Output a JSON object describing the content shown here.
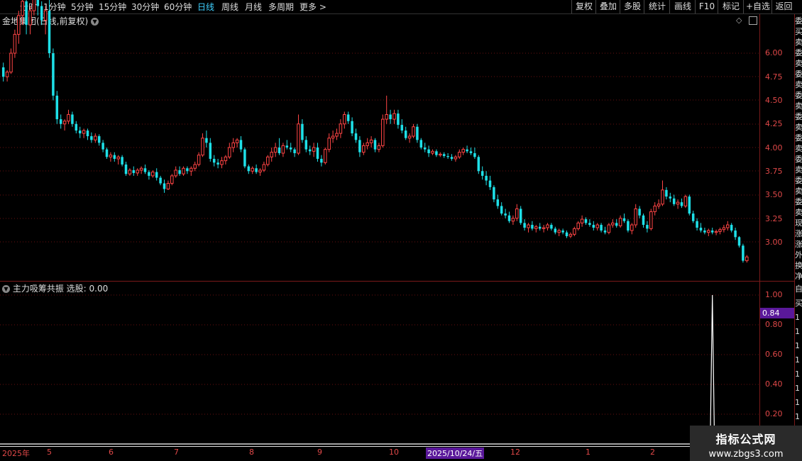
{
  "toolbar": {
    "periods": [
      "分时",
      "1分钟",
      "5分钟",
      "15分钟",
      "30分钟",
      "60分钟",
      "日线",
      "周线",
      "月线",
      "多周期",
      "更多 >"
    ],
    "active_period": "日线",
    "right_buttons": [
      "复权",
      "叠加",
      "多股",
      "统计",
      "画线",
      "F10",
      "标记",
      "+自选",
      "返回"
    ]
  },
  "main_chart": {
    "title": "金地集团(日线,前复权)",
    "y_ticks": [
      "6.00",
      "4.75",
      "4.50",
      "4.25",
      "4.00",
      "3.75",
      "3.50",
      "3.25",
      "3.00"
    ]
  },
  "indicator": {
    "title": "主力吸筹共振",
    "select_label": "选股: 0.00",
    "current_value": "0.84",
    "y_ticks": [
      "1.00",
      "0.80",
      "0.60",
      "0.40",
      "0.20"
    ]
  },
  "x_axis": {
    "labels": [
      "2025年",
      "5",
      "6",
      "7",
      "8",
      "9",
      "10",
      "2025/10/24/五",
      "12",
      "1",
      "2"
    ],
    "highlight": "2025/10/24/五"
  },
  "watermark": {
    "line1": "指标公式网",
    "line2": "www.zbgs3.com"
  },
  "side_column": {
    "top_chars": "委买卖委卖委卖委卖委卖委卖委卖委卖委卖现涨涨外换净收",
    "bottom_chars": "自买1111111111"
  },
  "colors": {
    "up": "#ff4545",
    "down": "#1ee0e8",
    "axis": "#e04848",
    "highlight": "#5a189a"
  },
  "chart_data": {
    "type": "candlestick",
    "ohlc": [
      [
        4.85,
        4.9,
        4.7,
        4.75
      ],
      [
        4.75,
        4.82,
        4.7,
        4.8
      ],
      [
        4.8,
        5.05,
        4.78,
        5.0
      ],
      [
        5.0,
        5.25,
        4.95,
        5.2
      ],
      [
        5.2,
        5.45,
        5.1,
        5.4
      ],
      [
        5.4,
        5.6,
        5.3,
        5.55
      ],
      [
        5.55,
        5.6,
        5.2,
        5.3
      ],
      [
        5.3,
        5.5,
        5.2,
        5.45
      ],
      [
        5.45,
        5.7,
        5.4,
        5.65
      ],
      [
        5.65,
        5.7,
        5.4,
        5.5
      ],
      [
        5.5,
        5.55,
        5.3,
        5.35
      ],
      [
        5.35,
        5.5,
        5.2,
        5.45
      ],
      [
        5.45,
        5.6,
        4.95,
        5.0
      ],
      [
        5.0,
        5.05,
        4.5,
        4.55
      ],
      [
        4.55,
        4.6,
        4.25,
        4.3
      ],
      [
        4.3,
        4.35,
        4.2,
        4.25
      ],
      [
        4.25,
        4.3,
        4.18,
        4.28
      ],
      [
        4.28,
        4.4,
        4.25,
        4.35
      ],
      [
        4.35,
        4.38,
        4.22,
        4.25
      ],
      [
        4.25,
        4.28,
        4.15,
        4.18
      ],
      [
        4.18,
        4.22,
        4.1,
        4.15
      ],
      [
        4.15,
        4.2,
        4.1,
        4.18
      ],
      [
        4.18,
        4.2,
        4.08,
        4.12
      ],
      [
        4.12,
        4.16,
        4.05,
        4.08
      ],
      [
        4.08,
        4.15,
        4.05,
        4.12
      ],
      [
        4.12,
        4.14,
        4.02,
        4.05
      ],
      [
        4.05,
        4.08,
        3.95,
        3.98
      ],
      [
        3.98,
        4.0,
        3.88,
        3.9
      ],
      [
        3.9,
        3.95,
        3.85,
        3.92
      ],
      [
        3.92,
        3.95,
        3.85,
        3.88
      ],
      [
        3.88,
        3.92,
        3.82,
        3.9
      ],
      [
        3.9,
        3.92,
        3.8,
        3.82
      ],
      [
        3.82,
        3.85,
        3.7,
        3.72
      ],
      [
        3.72,
        3.78,
        3.7,
        3.76
      ],
      [
        3.76,
        3.8,
        3.7,
        3.73
      ],
      [
        3.73,
        3.78,
        3.7,
        3.76
      ],
      [
        3.76,
        3.8,
        3.72,
        3.78
      ],
      [
        3.78,
        3.82,
        3.72,
        3.74
      ],
      [
        3.74,
        3.76,
        3.66,
        3.7
      ],
      [
        3.7,
        3.76,
        3.68,
        3.74
      ],
      [
        3.74,
        3.78,
        3.65,
        3.68
      ],
      [
        3.68,
        3.7,
        3.6,
        3.62
      ],
      [
        3.62,
        3.66,
        3.52,
        3.56
      ],
      [
        3.56,
        3.65,
        3.55,
        3.62
      ],
      [
        3.62,
        3.72,
        3.6,
        3.7
      ],
      [
        3.7,
        3.8,
        3.68,
        3.76
      ],
      [
        3.76,
        3.8,
        3.7,
        3.72
      ],
      [
        3.72,
        3.8,
        3.7,
        3.78
      ],
      [
        3.78,
        3.8,
        3.72,
        3.75
      ],
      [
        3.75,
        3.8,
        3.7,
        3.78
      ],
      [
        3.78,
        3.85,
        3.75,
        3.82
      ],
      [
        3.82,
        3.95,
        3.8,
        3.92
      ],
      [
        3.92,
        4.15,
        3.9,
        4.1
      ],
      [
        4.1,
        4.18,
        4.0,
        4.05
      ],
      [
        4.05,
        4.1,
        3.85,
        3.88
      ],
      [
        3.88,
        3.92,
        3.8,
        3.84
      ],
      [
        3.84,
        3.88,
        3.78,
        3.82
      ],
      [
        3.82,
        3.9,
        3.78,
        3.86
      ],
      [
        3.86,
        3.92,
        3.82,
        3.9
      ],
      [
        3.9,
        4.05,
        3.88,
        4.0
      ],
      [
        4.0,
        4.1,
        3.95,
        4.05
      ],
      [
        4.05,
        4.1,
        4.0,
        4.08
      ],
      [
        4.08,
        4.12,
        3.95,
        3.98
      ],
      [
        3.98,
        4.0,
        3.78,
        3.8
      ],
      [
        3.8,
        3.82,
        3.72,
        3.75
      ],
      [
        3.75,
        3.8,
        3.72,
        3.78
      ],
      [
        3.78,
        3.82,
        3.72,
        3.74
      ],
      [
        3.74,
        3.78,
        3.7,
        3.76
      ],
      [
        3.76,
        3.85,
        3.74,
        3.82
      ],
      [
        3.82,
        3.92,
        3.8,
        3.9
      ],
      [
        3.9,
        4.0,
        3.85,
        3.95
      ],
      [
        3.95,
        4.05,
        3.9,
        4.0
      ],
      [
        4.0,
        4.1,
        3.92,
        3.94
      ],
      [
        3.94,
        4.05,
        3.9,
        4.02
      ],
      [
        4.02,
        4.08,
        3.98,
        4.0
      ],
      [
        4.0,
        4.05,
        3.95,
        3.98
      ],
      [
        3.98,
        4.0,
        3.9,
        3.94
      ],
      [
        3.94,
        4.35,
        3.92,
        4.25
      ],
      [
        4.25,
        4.3,
        4.05,
        4.08
      ],
      [
        4.08,
        4.12,
        3.95,
        3.98
      ],
      [
        3.98,
        4.02,
        3.92,
        3.96
      ],
      [
        3.96,
        4.05,
        3.9,
        4.0
      ],
      [
        4.0,
        4.05,
        3.85,
        3.88
      ],
      [
        3.88,
        3.92,
        3.8,
        3.84
      ],
      [
        3.84,
        4.0,
        3.82,
        3.98
      ],
      [
        3.98,
        4.15,
        3.95,
        4.1
      ],
      [
        4.1,
        4.18,
        4.05,
        4.12
      ],
      [
        4.12,
        4.2,
        4.08,
        4.15
      ],
      [
        4.15,
        4.3,
        4.1,
        4.25
      ],
      [
        4.25,
        4.38,
        4.2,
        4.35
      ],
      [
        4.35,
        4.38,
        4.25,
        4.28
      ],
      [
        4.28,
        4.32,
        4.12,
        4.15
      ],
      [
        4.15,
        4.2,
        4.05,
        4.08
      ],
      [
        4.08,
        4.12,
        3.9,
        3.95
      ],
      [
        3.95,
        4.05,
        3.92,
        4.02
      ],
      [
        4.02,
        4.1,
        3.98,
        4.05
      ],
      [
        4.05,
        4.12,
        4.0,
        4.08
      ],
      [
        4.08,
        4.1,
        3.95,
        3.98
      ],
      [
        3.98,
        4.05,
        3.95,
        4.02
      ],
      [
        4.02,
        4.35,
        4.0,
        4.3
      ],
      [
        4.3,
        4.55,
        4.25,
        4.35
      ],
      [
        4.35,
        4.4,
        4.25,
        4.3
      ],
      [
        4.3,
        4.4,
        4.25,
        4.36
      ],
      [
        4.36,
        4.4,
        4.2,
        4.24
      ],
      [
        4.24,
        4.3,
        4.15,
        4.18
      ],
      [
        4.18,
        4.22,
        4.08,
        4.1
      ],
      [
        4.1,
        4.15,
        4.05,
        4.12
      ],
      [
        4.12,
        4.25,
        4.1,
        4.22
      ],
      [
        4.22,
        4.25,
        4.05,
        4.08
      ],
      [
        4.08,
        4.1,
        3.98,
        4.0
      ],
      [
        4.0,
        4.05,
        3.95,
        3.98
      ],
      [
        3.98,
        4.02,
        3.9,
        3.94
      ],
      [
        3.94,
        3.98,
        3.92,
        3.96
      ],
      [
        3.96,
        3.98,
        3.9,
        3.92
      ],
      [
        3.92,
        3.95,
        3.9,
        3.93
      ],
      [
        3.93,
        3.95,
        3.89,
        3.91
      ],
      [
        3.91,
        3.94,
        3.88,
        3.9
      ],
      [
        3.9,
        3.93,
        3.86,
        3.88
      ],
      [
        3.88,
        3.92,
        3.85,
        3.9
      ],
      [
        3.9,
        3.98,
        3.88,
        3.95
      ],
      [
        3.95,
        4.0,
        3.92,
        3.98
      ],
      [
        3.98,
        4.02,
        3.94,
        3.96
      ],
      [
        3.96,
        4.0,
        3.92,
        3.94
      ],
      [
        3.94,
        4.0,
        3.88,
        3.9
      ],
      [
        3.9,
        3.92,
        3.72,
        3.75
      ],
      [
        3.75,
        3.8,
        3.66,
        3.7
      ],
      [
        3.7,
        3.75,
        3.6,
        3.65
      ],
      [
        3.65,
        3.7,
        3.55,
        3.58
      ],
      [
        3.58,
        3.6,
        3.42,
        3.45
      ],
      [
        3.45,
        3.5,
        3.35,
        3.38
      ],
      [
        3.38,
        3.42,
        3.28,
        3.3
      ],
      [
        3.3,
        3.35,
        3.25,
        3.28
      ],
      [
        3.28,
        3.32,
        3.2,
        3.22
      ],
      [
        3.22,
        3.28,
        3.18,
        3.25
      ],
      [
        3.25,
        3.4,
        3.22,
        3.35
      ],
      [
        3.35,
        3.38,
        3.18,
        3.2
      ],
      [
        3.2,
        3.24,
        3.12,
        3.15
      ],
      [
        3.15,
        3.2,
        3.1,
        3.18
      ],
      [
        3.18,
        3.22,
        3.12,
        3.14
      ],
      [
        3.14,
        3.18,
        3.1,
        3.16
      ],
      [
        3.16,
        3.2,
        3.12,
        3.14
      ],
      [
        3.14,
        3.18,
        3.1,
        3.15
      ],
      [
        3.15,
        3.2,
        3.12,
        3.18
      ],
      [
        3.18,
        3.2,
        3.12,
        3.14
      ],
      [
        3.14,
        3.16,
        3.08,
        3.1
      ],
      [
        3.1,
        3.14,
        3.06,
        3.12
      ],
      [
        3.12,
        3.14,
        3.08,
        3.1
      ],
      [
        3.1,
        3.12,
        3.04,
        3.06
      ],
      [
        3.06,
        3.1,
        3.04,
        3.08
      ],
      [
        3.08,
        3.16,
        3.06,
        3.14
      ],
      [
        3.14,
        3.22,
        3.12,
        3.2
      ],
      [
        3.2,
        3.28,
        3.16,
        3.24
      ],
      [
        3.24,
        3.26,
        3.18,
        3.2
      ],
      [
        3.2,
        3.24,
        3.16,
        3.18
      ],
      [
        3.18,
        3.22,
        3.12,
        3.15
      ],
      [
        3.15,
        3.2,
        3.12,
        3.18
      ],
      [
        3.18,
        3.2,
        3.1,
        3.12
      ],
      [
        3.12,
        3.16,
        3.08,
        3.1
      ],
      [
        3.1,
        3.2,
        3.08,
        3.18
      ],
      [
        3.18,
        3.24,
        3.15,
        3.2
      ],
      [
        3.2,
        3.24,
        3.15,
        3.17
      ],
      [
        3.17,
        3.28,
        3.15,
        3.25
      ],
      [
        3.25,
        3.3,
        3.2,
        3.22
      ],
      [
        3.22,
        3.24,
        3.1,
        3.12
      ],
      [
        3.12,
        3.2,
        3.08,
        3.18
      ],
      [
        3.18,
        3.4,
        3.15,
        3.35
      ],
      [
        3.35,
        3.38,
        3.25,
        3.28
      ],
      [
        3.28,
        3.3,
        3.15,
        3.18
      ],
      [
        3.18,
        3.22,
        3.1,
        3.14
      ],
      [
        3.14,
        3.35,
        3.12,
        3.32
      ],
      [
        3.32,
        3.42,
        3.28,
        3.38
      ],
      [
        3.38,
        3.45,
        3.35,
        3.4
      ],
      [
        3.4,
        3.65,
        3.38,
        3.55
      ],
      [
        3.55,
        3.58,
        3.45,
        3.48
      ],
      [
        3.48,
        3.52,
        3.42,
        3.46
      ],
      [
        3.46,
        3.5,
        3.38,
        3.4
      ],
      [
        3.4,
        3.45,
        3.35,
        3.42
      ],
      [
        3.42,
        3.46,
        3.36,
        3.38
      ],
      [
        3.38,
        3.5,
        3.36,
        3.48
      ],
      [
        3.48,
        3.5,
        3.28,
        3.3
      ],
      [
        3.3,
        3.33,
        3.2,
        3.22
      ],
      [
        3.22,
        3.25,
        3.12,
        3.15
      ],
      [
        3.15,
        3.2,
        3.1,
        3.12
      ],
      [
        3.12,
        3.15,
        3.08,
        3.1
      ],
      [
        3.1,
        3.14,
        3.06,
        3.12
      ],
      [
        3.12,
        3.15,
        3.08,
        3.1
      ],
      [
        3.1,
        3.13,
        3.07,
        3.11
      ],
      [
        3.11,
        3.15,
        3.08,
        3.13
      ],
      [
        3.13,
        3.18,
        3.1,
        3.15
      ],
      [
        3.15,
        3.22,
        3.12,
        3.18
      ],
      [
        3.18,
        3.2,
        3.1,
        3.12
      ],
      [
        3.12,
        3.15,
        3.02,
        3.05
      ],
      [
        3.05,
        3.06,
        2.94,
        2.96
      ],
      [
        2.96,
        2.98,
        2.78,
        2.8
      ],
      [
        2.8,
        2.86,
        2.78,
        2.84
      ]
    ],
    "indicator_series": {
      "name": "主力吸筹共振",
      "spike_bar_index": 185,
      "spike_value": 1.0,
      "baseline": 0.0
    },
    "main_ylim": [
      2.75,
      6.2
    ],
    "indicator_ylim": [
      0,
      1.05
    ]
  }
}
